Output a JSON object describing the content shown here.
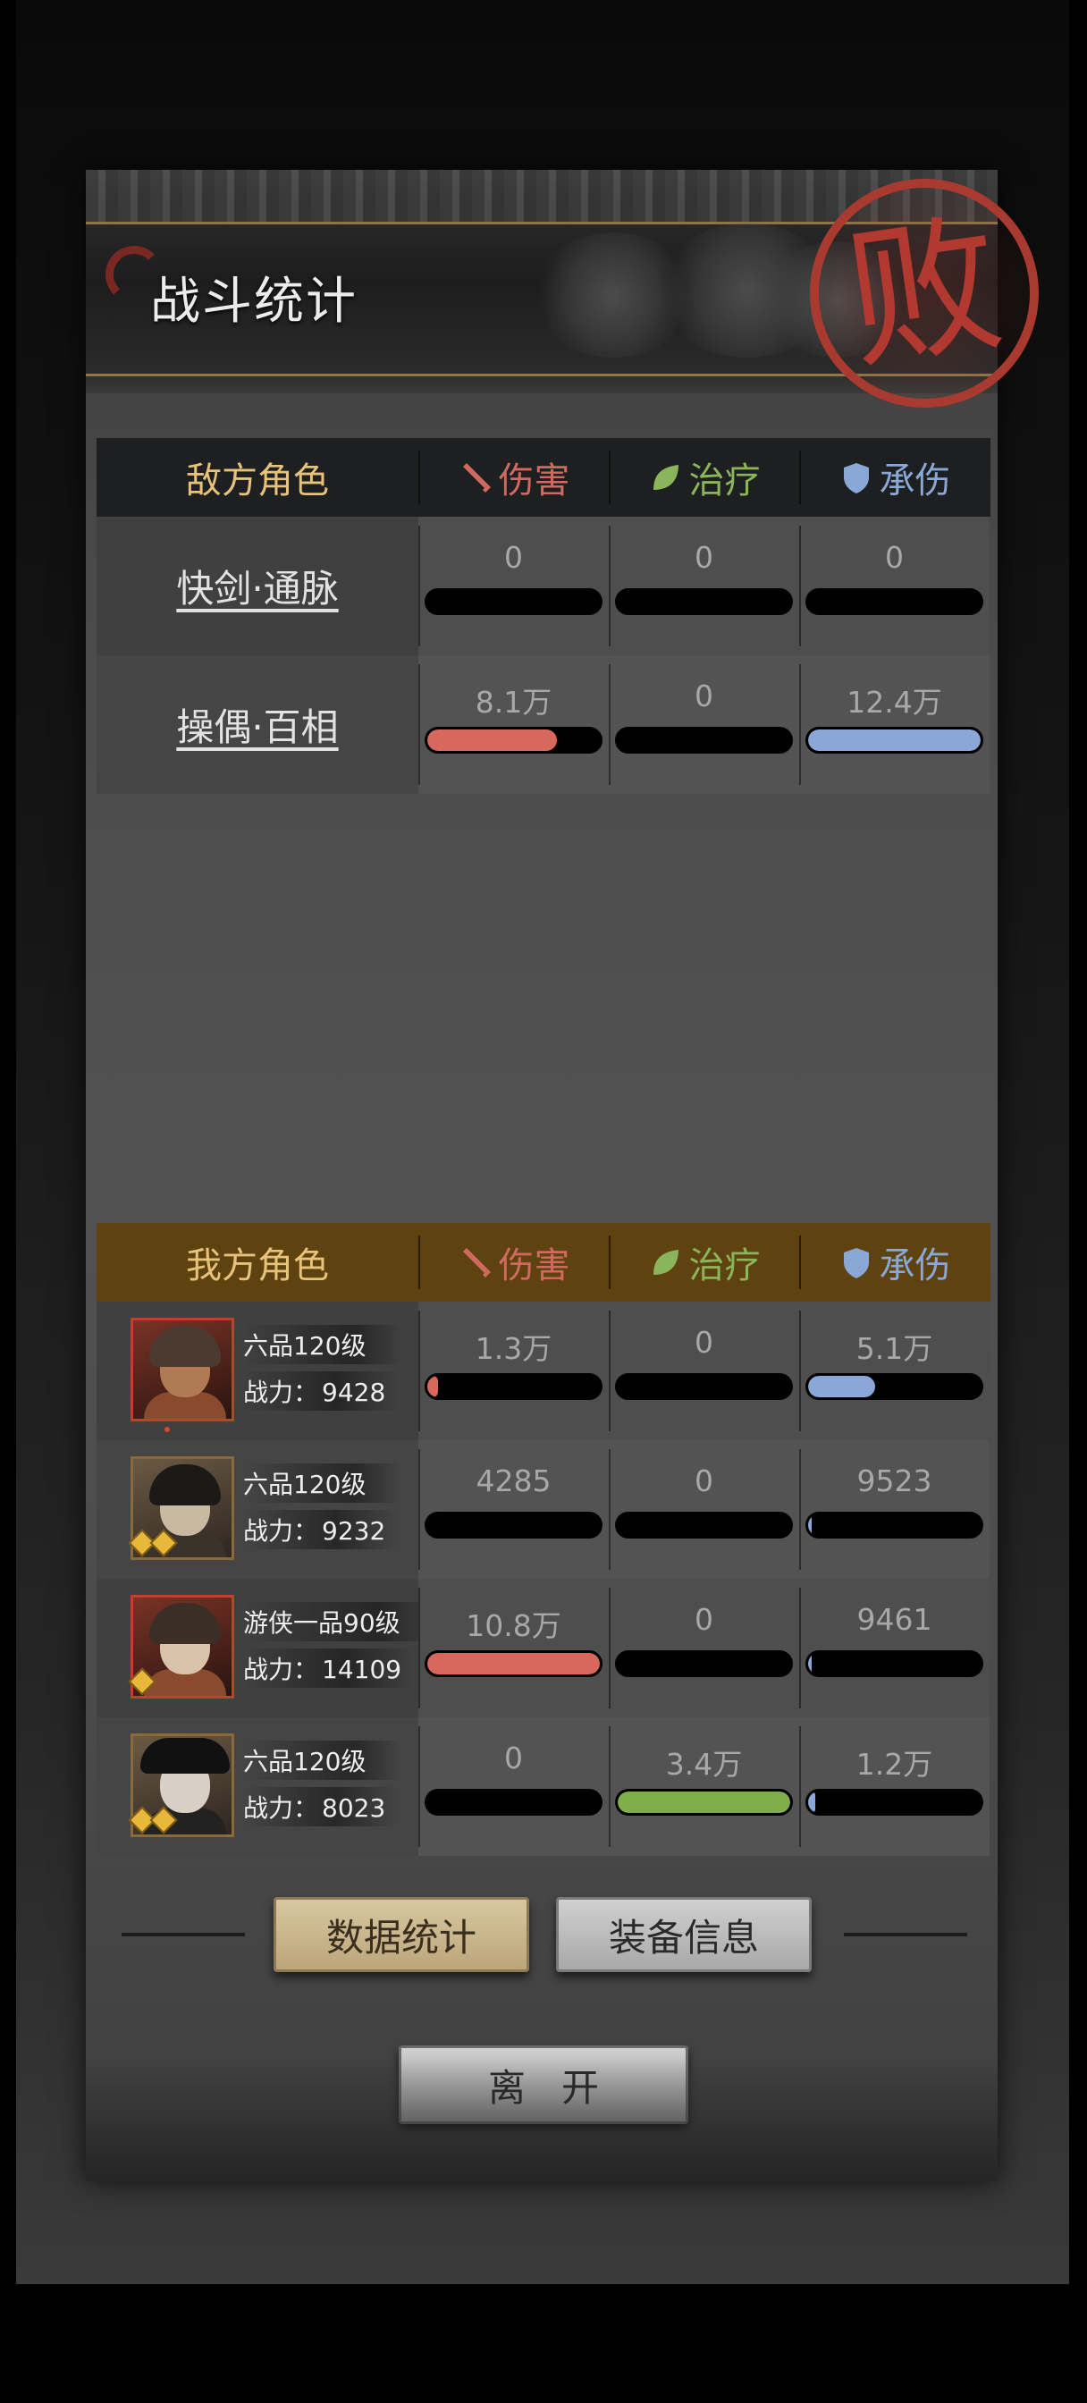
{
  "header": {
    "title": "战斗统计",
    "seal_char": "败"
  },
  "columns": {
    "damage": "伤害",
    "heal": "治疗",
    "tank": "承伤"
  },
  "enemy": {
    "heading": "敌方角色",
    "rows": [
      {
        "name": "快剑·通脉",
        "damage": "0",
        "heal": "0",
        "tank": "0",
        "damage_fill": 0,
        "heal_fill": 0,
        "tank_fill": 0
      },
      {
        "name": "操偶·百相",
        "damage": "8.1万",
        "heal": "0",
        "tank": "12.4万",
        "damage_fill": 0.75,
        "heal_fill": 0,
        "tank_fill": 1.0
      }
    ]
  },
  "ally": {
    "heading": "我方角色",
    "power_label": "战力：",
    "rows": [
      {
        "rank": "六品120级",
        "power": "9428",
        "damage": "1.3万",
        "heal": "0",
        "tank": "5.1万",
        "damage_fill": 0.06,
        "heal_fill": 0,
        "tank_fill": 0.39
      },
      {
        "rank": "六品120级",
        "power": "9232",
        "damage": "4285",
        "heal": "0",
        "tank": "9523",
        "damage_fill": 0,
        "heal_fill": 0,
        "tank_fill": 0.02
      },
      {
        "rank": "游侠一品90级",
        "power": "14109",
        "damage": "10.8万",
        "heal": "0",
        "tank": "9461",
        "damage_fill": 1.0,
        "heal_fill": 0,
        "tank_fill": 0.02
      },
      {
        "rank": "六品120级",
        "power": "8023",
        "damage": "0",
        "heal": "3.4万",
        "tank": "1.2万",
        "damage_fill": 0,
        "heal_fill": 1.0,
        "tank_fill": 0.04
      }
    ]
  },
  "buttons": {
    "stats": "数据统计",
    "equipment": "装备信息",
    "leave": "离开"
  },
  "colors": {
    "damage": "#d9685c",
    "heal": "#7fae4a",
    "tank": "#8ba7d8",
    "gold": "#e6c27a",
    "seal": "#b2392f"
  }
}
